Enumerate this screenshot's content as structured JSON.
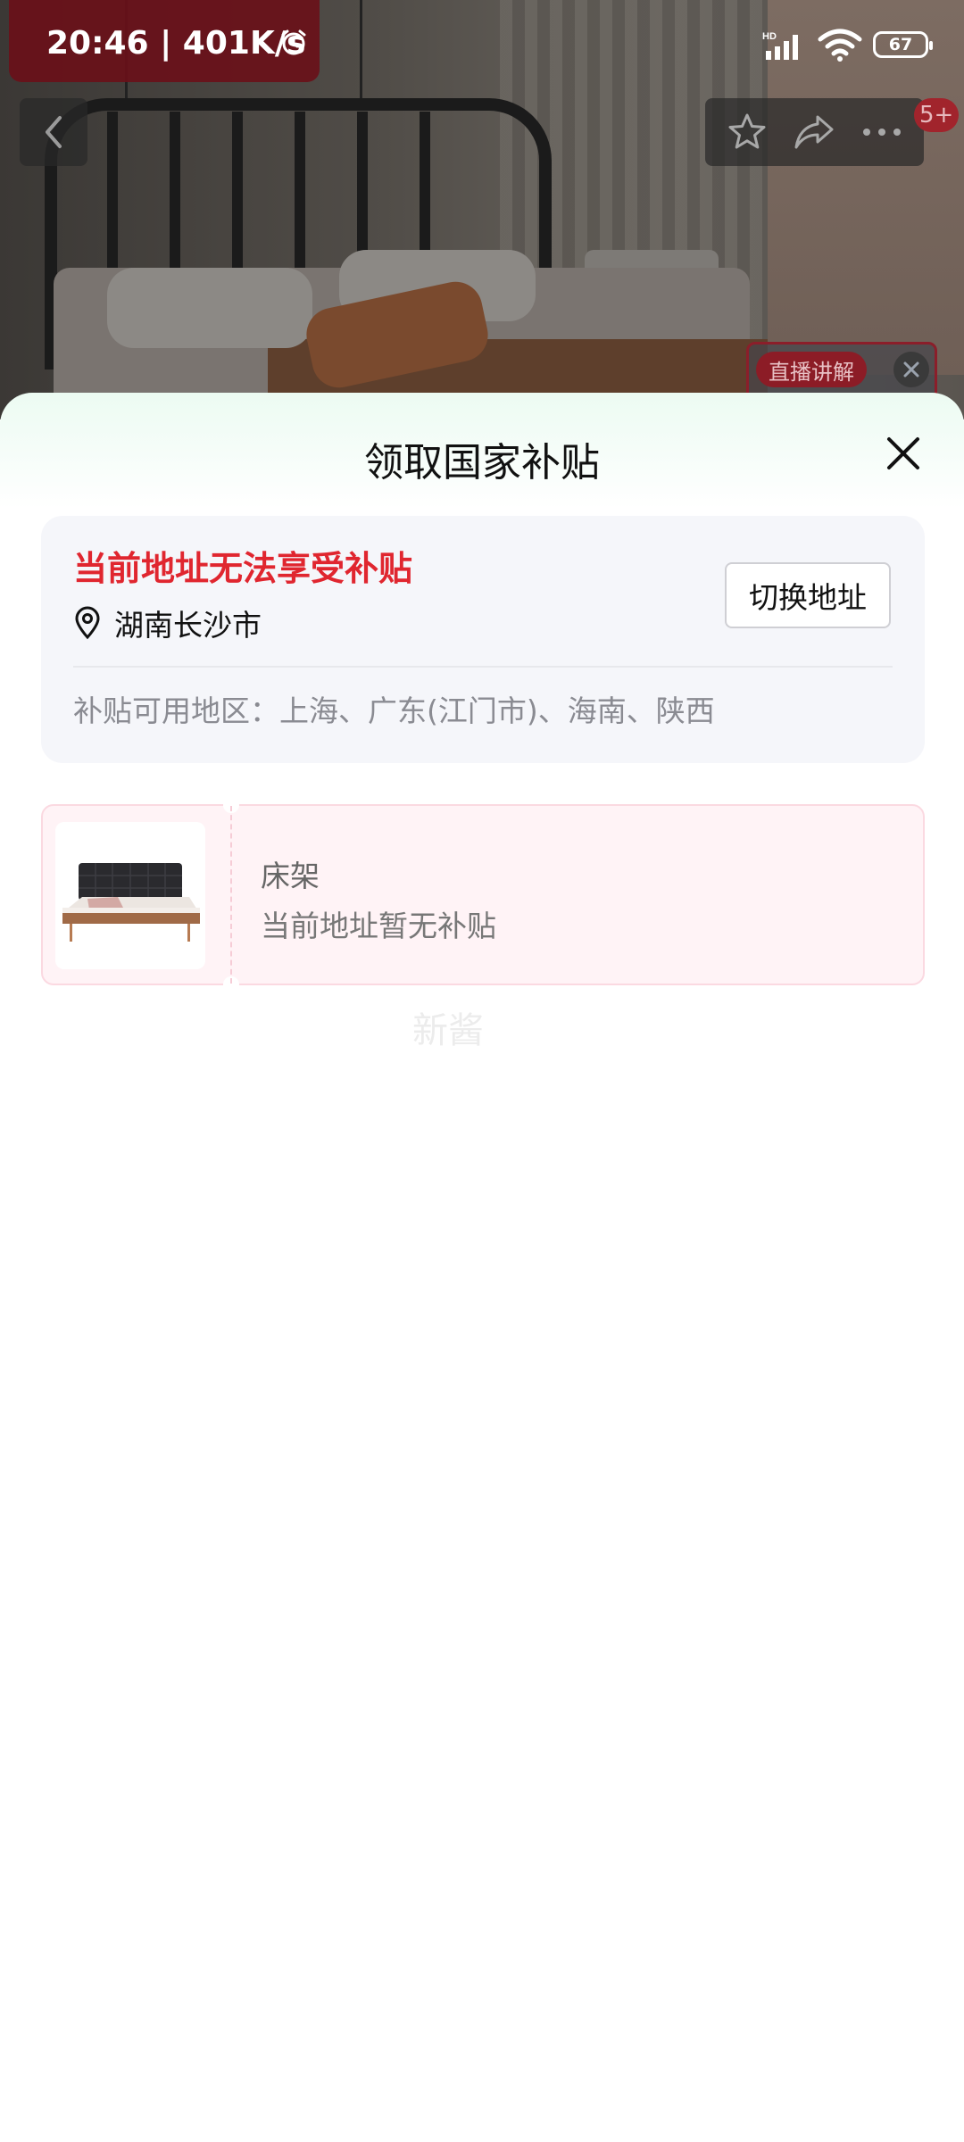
{
  "status_bar": {
    "time": "20:46 | 401K/s",
    "network": "HD",
    "battery": "67"
  },
  "live": {
    "label": "直播讲解"
  },
  "nav": {
    "message_badge": "5+"
  },
  "sheet": {
    "title": "领取国家补贴",
    "address_card": {
      "warning": "当前地址无法享受补贴",
      "location": "湖南长沙市",
      "switch_button": "切换地址",
      "regions": "补贴可用地区：上海、广东(江门市)、海南、陕西"
    },
    "product": {
      "name": "床架",
      "status": "当前地址暂无补贴"
    },
    "ghost_text": "新酱"
  },
  "colors": {
    "warning_red": "#e0262f",
    "sheet_top_tint": "#ecfbf2",
    "product_bg": "#fff3f6"
  }
}
